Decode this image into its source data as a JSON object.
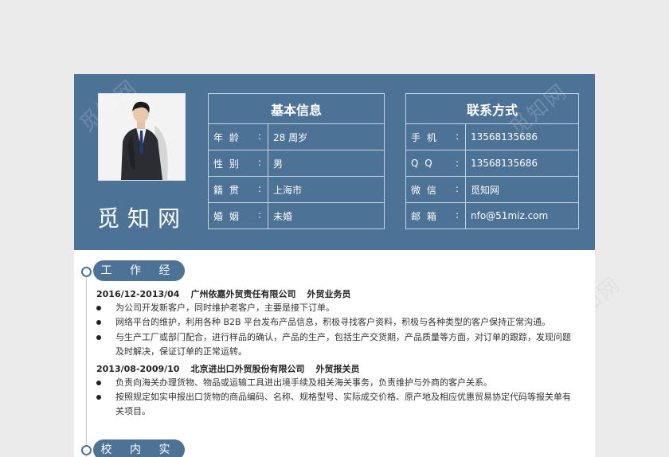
{
  "watermark": "觅知网",
  "profile": {
    "name": "觅知网"
  },
  "basic_info": {
    "title": "基本信息",
    "rows": [
      {
        "label": "年 龄",
        "value": "28 周岁"
      },
      {
        "label": "性 别",
        "value": "男"
      },
      {
        "label": "籍 贯",
        "value": "上海市"
      },
      {
        "label": "婚 姻",
        "value": "未婚"
      }
    ]
  },
  "contact": {
    "title": "联系方式",
    "rows": [
      {
        "label": "手 机",
        "value": "13568135686"
      },
      {
        "label": "Q Q",
        "value": "13568135686"
      },
      {
        "label": "微 信",
        "value": "觅知网"
      },
      {
        "label": "邮 箱",
        "value": "nfo@51miz.com"
      }
    ]
  },
  "colon": ":",
  "sections": {
    "work": "工 作 经 历",
    "campus": "校 内 实 践"
  },
  "jobs": [
    {
      "period": "2016/12-2013/04",
      "company": "广州依嘉外贸责任有限公司",
      "position": "外贸业务员",
      "duties": [
        "为公司开发新客户，同时维护老客户，主要是接下订单。",
        "网络平台的维护，利用各种 B2B 平台发布产品信息，积极寻找客户资料，积极与各种类型的客户保持正常沟通。",
        "与生产工厂或部门配合，进行样品的确认，产品的生产，包括生产交货期，产品质量等方面，对订单的跟踪，发现问题及时解决，保证订单的正常运转。"
      ]
    },
    {
      "period": "2013/08-2009/10",
      "company": "北京进出口外贸股份有限公司",
      "position": "外贸报关员",
      "duties": [
        "负责向海关办理货物、物品或运输工具进出境手续及相关海关事务，负责维护与外商的客户关系。",
        "按照规定如实申报出口货物的商品编码、名称、规格型号、实际成交价格、原产地及相应优惠贸易协定代码等报关单有关项目。"
      ]
    }
  ]
}
